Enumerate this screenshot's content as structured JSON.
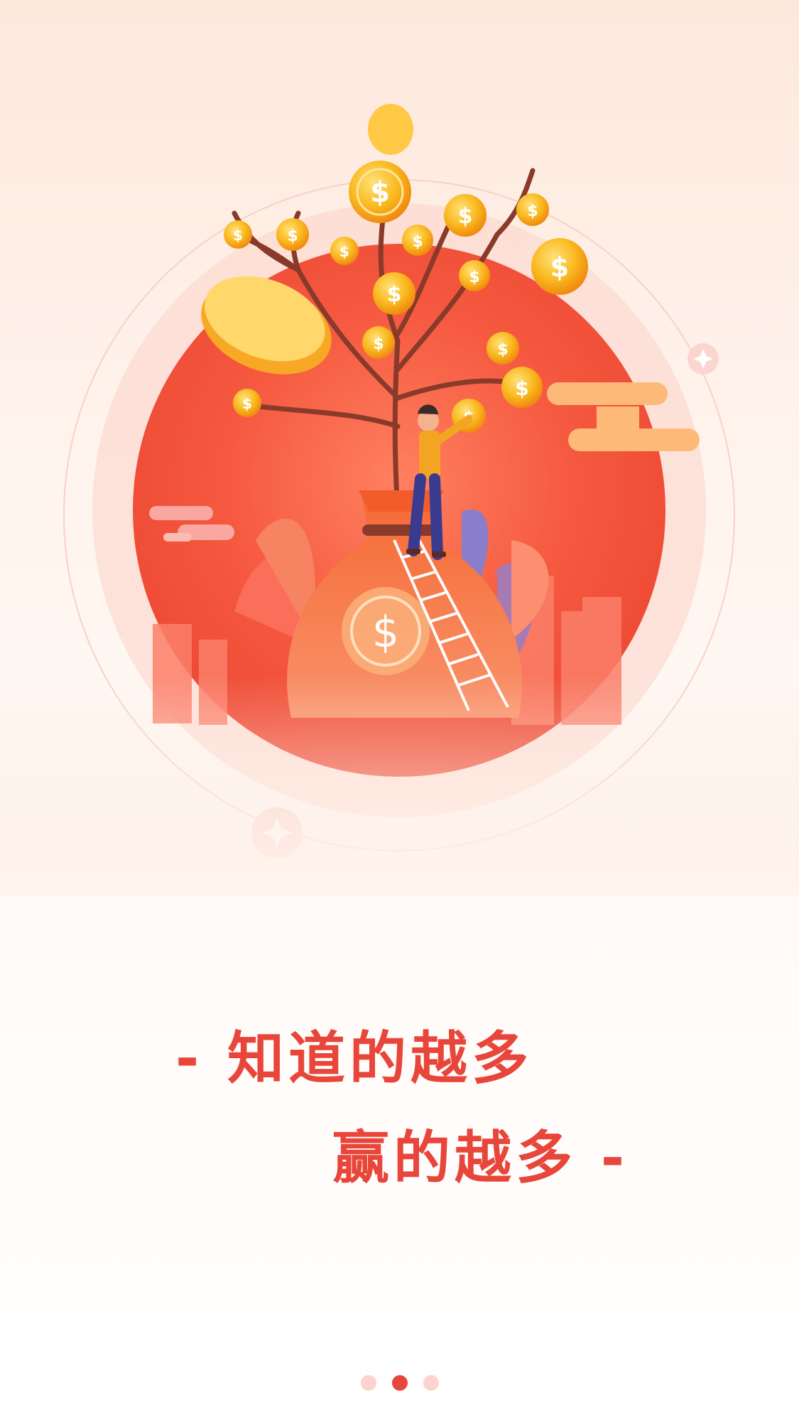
{
  "slogan": {
    "line1": "- 知道的越多",
    "line2": "赢的越多 -"
  },
  "pager": {
    "count": 3,
    "active_index": 1
  },
  "colors": {
    "accent": "#e8463a",
    "circle": "#f2553f",
    "coin": "#f7b21d",
    "dot_inactive": "#fbd3cf"
  }
}
